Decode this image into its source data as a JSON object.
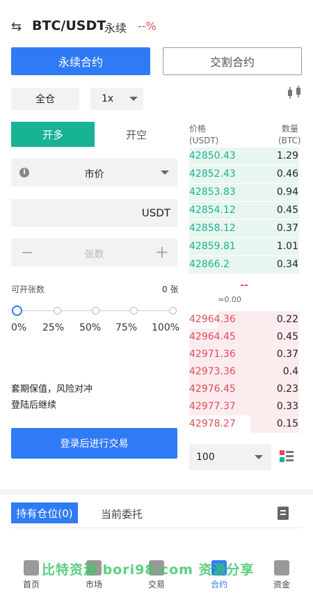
{
  "header": {
    "pair": "BTC/USDT",
    "contract_type": "永续",
    "change_pct": "--%"
  },
  "contract_tabs": {
    "perpetual": "永续合约",
    "delivery": "交割合约"
  },
  "margin": {
    "mode": "全仓",
    "leverage": "1x"
  },
  "side_tabs": {
    "buy": "开多",
    "sell": "开空"
  },
  "order": {
    "type": "市价",
    "amount_unit": "USDT",
    "quantity_placeholder": "张数",
    "minus": "−",
    "plus": "+"
  },
  "available": {
    "label": "可开张数",
    "value": "0 张"
  },
  "slider": {
    "marks": [
      "0%",
      "25%",
      "50%",
      "75%",
      "100%"
    ],
    "value_pct": 0
  },
  "notes": {
    "line1": "套期保值，风险对冲",
    "line2": "登陆后继续"
  },
  "login_button": "登录后进行交易",
  "orderbook": {
    "price_label": "价格",
    "price_unit": "(USDT)",
    "qty_label": "数量",
    "qty_unit": "(BTC)",
    "bids": [
      {
        "price": "42850.43",
        "qty": "1.29"
      },
      {
        "price": "42852.43",
        "qty": "0.46"
      },
      {
        "price": "42853.83",
        "qty": "0.94"
      },
      {
        "price": "42854.12",
        "qty": "0.45"
      },
      {
        "price": "42858.12",
        "qty": "0.37"
      },
      {
        "price": "42859.81",
        "qty": "1.01"
      },
      {
        "price": "42866.2",
        "qty": "0.34"
      }
    ],
    "last_price": "--",
    "approx": "≈0.00",
    "asks": [
      {
        "price": "42964.36",
        "qty": "0.22"
      },
      {
        "price": "42964.45",
        "qty": "0.45"
      },
      {
        "price": "42971.36",
        "qty": "0.37"
      },
      {
        "price": "42973.36",
        "qty": "0.4"
      },
      {
        "price": "42976.45",
        "qty": "0.23"
      },
      {
        "price": "42977.37",
        "qty": "0.33"
      },
      {
        "price": "42978.27",
        "qty": "0.15"
      }
    ],
    "depth": "100"
  },
  "positions": {
    "tab_holdings": "持有仓位(0)",
    "tab_orders": "当前委托"
  },
  "watermark": "比特资源 bori98.com 资源分享",
  "nav": [
    {
      "label": "首页"
    },
    {
      "label": "市场"
    },
    {
      "label": "交易"
    },
    {
      "label": "合约"
    },
    {
      "label": "资金"
    }
  ],
  "colors": {
    "accent": "#2f7bf6",
    "buy": "#17b393",
    "sell": "#e24a5a"
  }
}
